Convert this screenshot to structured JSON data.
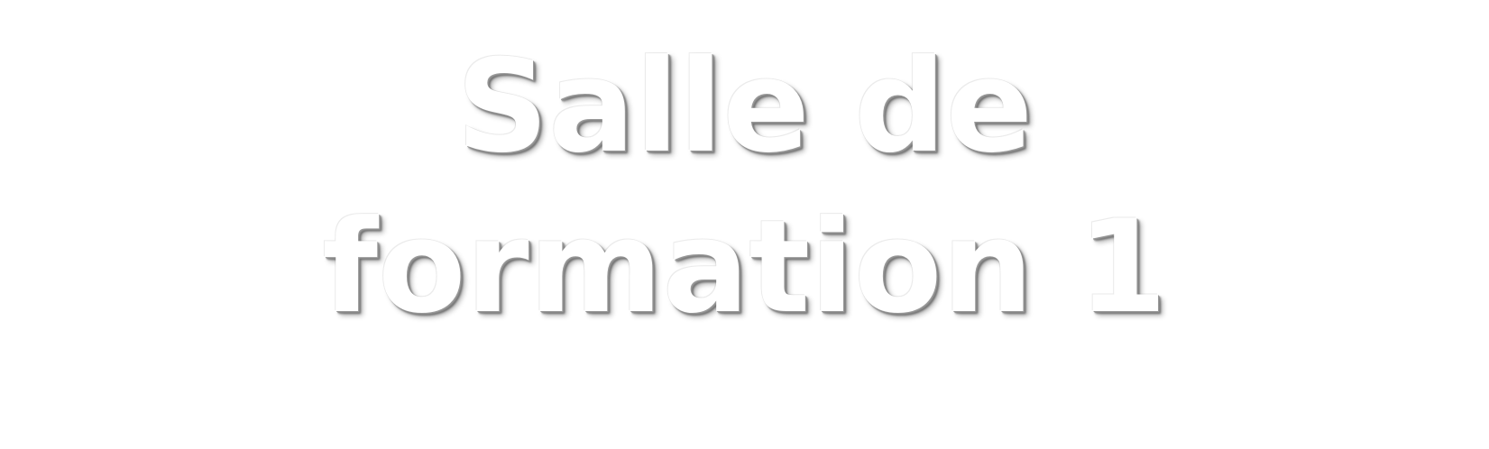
{
  "sign": {
    "line1": "Salle de",
    "line2": "formation 1"
  },
  "colors": {
    "background": "#ffffff",
    "text": "#ffffff",
    "shadow": "#8c8c8c"
  }
}
